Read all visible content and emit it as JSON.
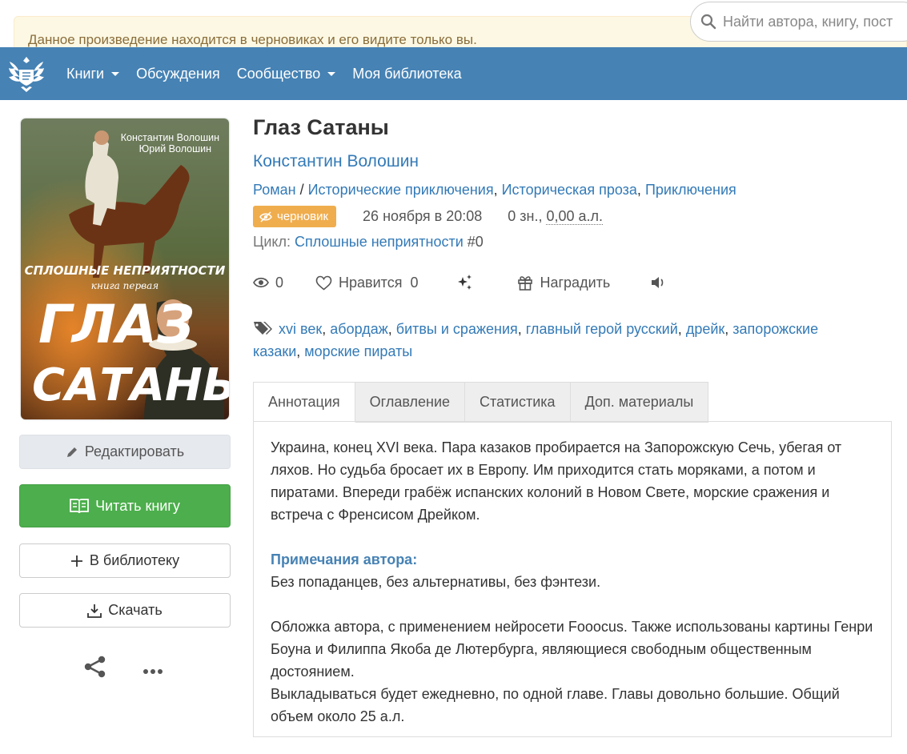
{
  "search": {
    "placeholder": "Найти автора, книгу, пост"
  },
  "notice": {
    "text": "Данное произведение находится в черновиках и его видите только вы."
  },
  "nav": {
    "items": [
      {
        "label": "Книги",
        "dropdown": true
      },
      {
        "label": "Обсуждения",
        "dropdown": false
      },
      {
        "label": "Сообщество",
        "dropdown": true
      },
      {
        "label": "Моя библиотека",
        "dropdown": false
      }
    ]
  },
  "cover": {
    "authors_top": "Константин Волошин",
    "authors_bottom": "Юрий Волошин",
    "series": "СПЛОШНЫЕ НЕПРИЯТНОСТИ",
    "part": "книга первая",
    "title_line1": "ГЛАЗ",
    "title_line2": "САТАНЫ"
  },
  "buttons": {
    "edit": "Редактировать",
    "read": "Читать книгу",
    "library": "В библиотеку",
    "download": "Скачать"
  },
  "book": {
    "title": "Глаз Сатаны",
    "author": "Константин Волошин",
    "form": "Роман",
    "genre_sep": " / ",
    "genres": [
      "Исторические приключения",
      "Историческая проза",
      "Приключения"
    ],
    "status_badge": "черновик",
    "date": "26 ноября в 20:08",
    "size_chars": "0 зн., ",
    "size_al": "0,00 а.л.",
    "cycle_label": "Цикл: ",
    "cycle_name": "Сплошные неприятности",
    "cycle_num": " #0"
  },
  "actions": {
    "views": "0",
    "like_label": "Нравится",
    "likes": "0",
    "award_label": "Наградить"
  },
  "tags": [
    "xvi век",
    "абордаж",
    "битвы и сражения",
    "главный герой русский",
    "дрейк",
    "запорожские казаки",
    "морские пираты"
  ],
  "tabs": [
    {
      "label": "Аннотация",
      "active": true
    },
    {
      "label": "Оглавление",
      "active": false
    },
    {
      "label": "Статистика",
      "active": false
    },
    {
      "label": "Доп. материалы",
      "active": false
    }
  ],
  "annotation": {
    "paragraph": "Украина, конец XVI века. Пара казаков пробирается на Запорожскую Сечь, убегая от ляхов. Но судьба бросает их в Европу. Им приходится стать моряками, а потом и пиратами. Впереди грабёж испанских колоний в Новом Свете, морские сражения и встреча с Френсисом Дрейком.",
    "notes_title": "Примечания автора:",
    "note1": "Без попаданцев, без альтернативы, без фэнтези.",
    "note2": "Обложка автора, с применением нейросети Fooocus. Также использованы картины Генри Боуна и Филиппа Якоба де Лютербурга, являющиеся свободным общественным достоянием.",
    "note3": "Выкладываться будет ежедневно, по одной главе. Главы довольно большие. Общий объем около 25 а.л."
  },
  "colors": {
    "navbar": "#4682b4",
    "link": "#337ab7",
    "read_button": "#4cae4c",
    "draft_badge": "#f0ad4e",
    "notice_bg": "#fcf8e3",
    "notice_text": "#8a6d3b"
  }
}
